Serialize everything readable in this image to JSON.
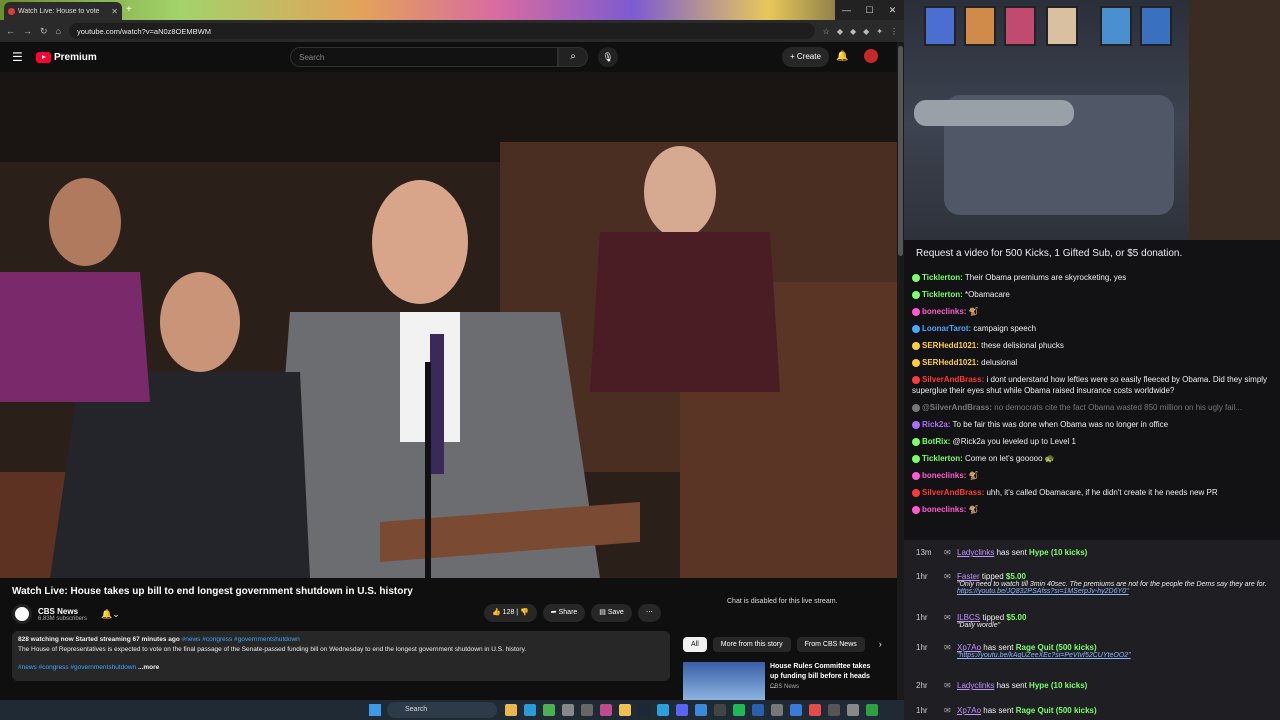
{
  "browser": {
    "tab_title": "Watch Live: House to vote",
    "url": "youtube.com/watch?v=aN0z8OEMBWM"
  },
  "youtube": {
    "logo_text": "Premium",
    "search_placeholder": "Search",
    "create_label": "Create",
    "video_title": "Watch Live: House takes up bill to end longest government shutdown in U.S. history",
    "channel_name": "CBS News",
    "subscribers": "6.83M subscribers",
    "likes": "128",
    "share_label": "Share",
    "save_label": "Save",
    "chat_disabled": "Chat is disabled for this live stream.",
    "desc_meta": "828 watching now  Started streaming 67 minutes ago",
    "desc_meta_tags": "#news #congress #governmentshutdown",
    "desc_text": "The House of Representatives is expected to vote on the final passage of the Senate-passed funding bill on Wednesday to end the longest government shutdown in U.S. history.",
    "desc_tags": "#news #congress #governmentshutdown",
    "desc_more": "...more",
    "chips": [
      "All",
      "More from this story",
      "From CBS News"
    ],
    "rec_title": "House Rules Committee takes up funding bill before it heads ...",
    "rec_channel": "CBS News"
  },
  "taskbar": {
    "search": "Search"
  },
  "stream": {
    "rules": "Request a video for 500 Kicks, 1 Gifted Sub, or $5 donation."
  },
  "chat": [
    {
      "user": "Ticklerton",
      "color": "#7cff6b",
      "text": "Their Obama premiums are skyrocketing, yes"
    },
    {
      "user": "Ticklerton",
      "color": "#7cff6b",
      "text": "*Obamacare"
    },
    {
      "user": "boneclinks",
      "color": "#ff5ad1",
      "text": "🐒"
    },
    {
      "user": "LoonarTarot",
      "color": "#4aa8ff",
      "text": "campaign speech"
    },
    {
      "user": "SERHedd1021",
      "color": "#ffcf3a",
      "text": "these delisional phucks"
    },
    {
      "user": "SERHedd1021",
      "color": "#ffcf3a",
      "text": "delusional"
    },
    {
      "user": "SilverAndBrass",
      "color": "#ff3a3a",
      "text": "i dont understand how lefties were so easily fleeced by Obama. Did they simply superglue their eyes shut while Obama raised insurance costs worldwide?"
    },
    {
      "user": "@SilverAndBrass",
      "color": "#777777",
      "text": "no democrats cite the fact Obama wasted 850 million on his ugly fail..."
    },
    {
      "user": "Rick2a",
      "color": "#a970ff",
      "text": "To be fair this was done when Obama was no longer in office"
    },
    {
      "user": "BotRix",
      "color": "#7cff6b",
      "text": "@Rick2a you leveled up to Level 1"
    },
    {
      "user": "Ticklerton",
      "color": "#7cff6b",
      "text": "Come on let's gooooo 🐢"
    },
    {
      "user": "boneclinks",
      "color": "#ff5ad1",
      "text": "🐒"
    },
    {
      "user": "SilverAndBrass",
      "color": "#ff3a3a",
      "text": "uhh, it's called Obamacare, if he didn't create it he needs new PR"
    },
    {
      "user": "boneclinks",
      "color": "#ff5ad1",
      "text": "🐒"
    }
  ],
  "events": [
    {
      "time": "13m",
      "name": "Ladyclinks",
      "text": "has sent",
      "hl": "Hype (10 kicks)",
      "quote": "",
      "link": ""
    },
    {
      "time": "1hr",
      "name": "Faster",
      "text": "tipped",
      "hl": "$5.00",
      "quote": "\"Only need to watch till 3min 40sec. The premiums are not for the people the Dems say they are for.",
      "link": "https://youtu.be/JQ832PSAfss?si=1MSerpJv-hy2D6Y0\""
    },
    {
      "time": "1hr",
      "name": "ILBCS",
      "text": "tipped",
      "hl": "$5.00",
      "quote": "\"Daily wordle\"",
      "link": ""
    },
    {
      "time": "1hr",
      "name": "Xp7Ao",
      "text": "has sent",
      "hl": "Rage Quit (500 kicks)",
      "quote": "",
      "link": "\"https://youtu.be/kAqUZeeXEc?si=PeVIvf52CUYteOO2\""
    },
    {
      "time": "2hr",
      "name": "Ladyclinks",
      "text": "has sent",
      "hl": "Hype (10 kicks)",
      "quote": "",
      "link": ""
    },
    {
      "time": "1hr",
      "name": "Xp7Ao",
      "text": "has sent",
      "hl": "Rage Quit (500 kicks)",
      "quote": "",
      "link": ""
    }
  ]
}
